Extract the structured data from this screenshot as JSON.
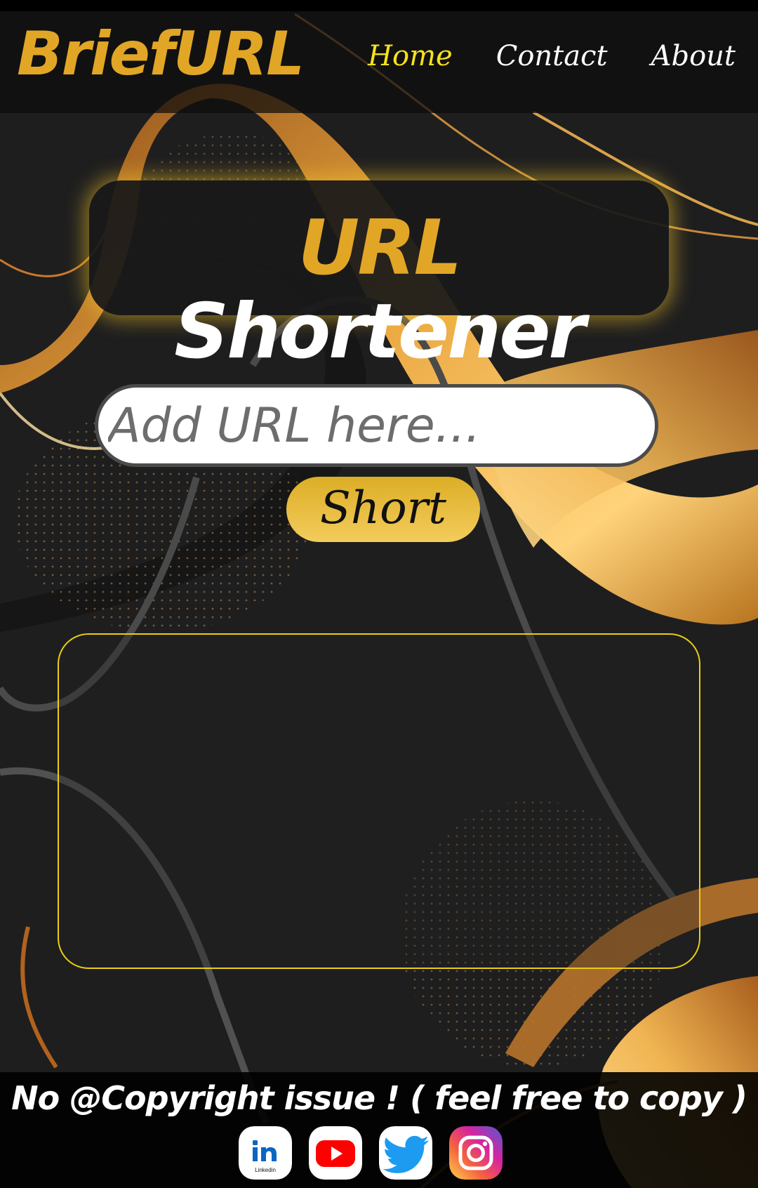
{
  "colors": {
    "brand": "#e2a626",
    "active_link": "#f7e11a",
    "background": "#1e1e1f",
    "result_border": "#ebcd15"
  },
  "navbar": {
    "logo": "BriefURL",
    "links": [
      {
        "label": "Home",
        "active": true
      },
      {
        "label": "Contact",
        "active": false
      },
      {
        "label": "About",
        "active": false
      }
    ]
  },
  "hero": {
    "title_part1": "URL",
    "title_part2": "Shortener"
  },
  "form": {
    "url_placeholder": "Add URL here...",
    "url_value": "",
    "submit_label": "Short"
  },
  "result": {
    "text": ""
  },
  "footer": {
    "text": "No @Copyright issue ! ( feel free to copy )",
    "socials": [
      {
        "name": "linkedin",
        "icon": "linkedin-icon",
        "caption": "Linkedin"
      },
      {
        "name": "youtube",
        "icon": "youtube-icon"
      },
      {
        "name": "twitter",
        "icon": "twitter-icon"
      },
      {
        "name": "instagram",
        "icon": "instagram-icon"
      }
    ]
  }
}
